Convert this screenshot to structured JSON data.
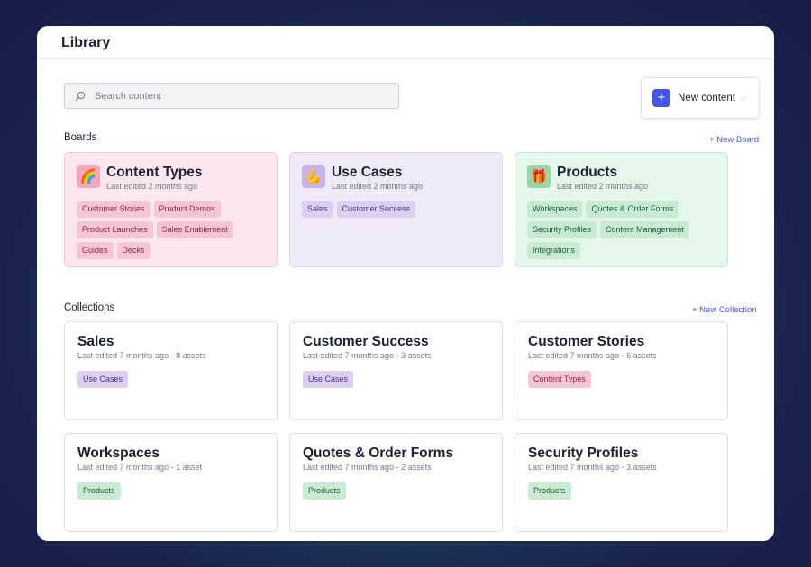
{
  "page": {
    "title": "Library"
  },
  "search": {
    "placeholder": "Search content",
    "value": "",
    "icon": "search-icon"
  },
  "new_content": {
    "label": "New content",
    "icon": "plus-icon"
  },
  "boards_section": {
    "title": "Boards",
    "new_label": "+ New Board",
    "items": [
      {
        "emoji": "🌈",
        "title": "Content Types",
        "subtitle": "Last edited 2 months ago",
        "tags": [
          "Customer Stories",
          "Product Demos",
          "Product Launches",
          "Sales Enablement",
          "Guides",
          "Decks"
        ]
      },
      {
        "emoji": "💪",
        "title": "Use Cases",
        "subtitle": "Last edited 2 months ago",
        "tags": [
          "Sales",
          "Customer Success"
        ]
      },
      {
        "emoji": "🎁",
        "title": "Products",
        "subtitle": "Last edited 2 months ago",
        "tags": [
          "Workspaces",
          "Quotes & Order Forms",
          "Security Profiles",
          "Content Management",
          "Integrations"
        ]
      }
    ]
  },
  "collections_section": {
    "title": "Collections",
    "new_label": "+ New Collection",
    "items": [
      {
        "title": "Sales",
        "subtitle": "Last edited 7 months ago - 8 assets",
        "tag": "Use Cases"
      },
      {
        "title": "Customer Success",
        "subtitle": "Last edited 7 months ago - 3 assets",
        "tag": "Use Cases"
      },
      {
        "title": "Customer Stories",
        "subtitle": "Last edited 7 months ago - 6 assets",
        "tag": "Content Types"
      },
      {
        "title": "Workspaces",
        "subtitle": "Last edited 7 months ago - 1 asset",
        "tag": "Products"
      },
      {
        "title": "Quotes & Order Forms",
        "subtitle": "Last edited 7 months ago - 2 assets",
        "tag": "Products"
      },
      {
        "title": "Security Profiles",
        "subtitle": "Last edited 7 months ago - 3 assets",
        "tag": "Products"
      }
    ]
  },
  "colors": {
    "accent": "#4655e8",
    "board_pink": "#fde7ee",
    "board_purple": "#efeaf8",
    "board_green": "#e5f6ea"
  }
}
